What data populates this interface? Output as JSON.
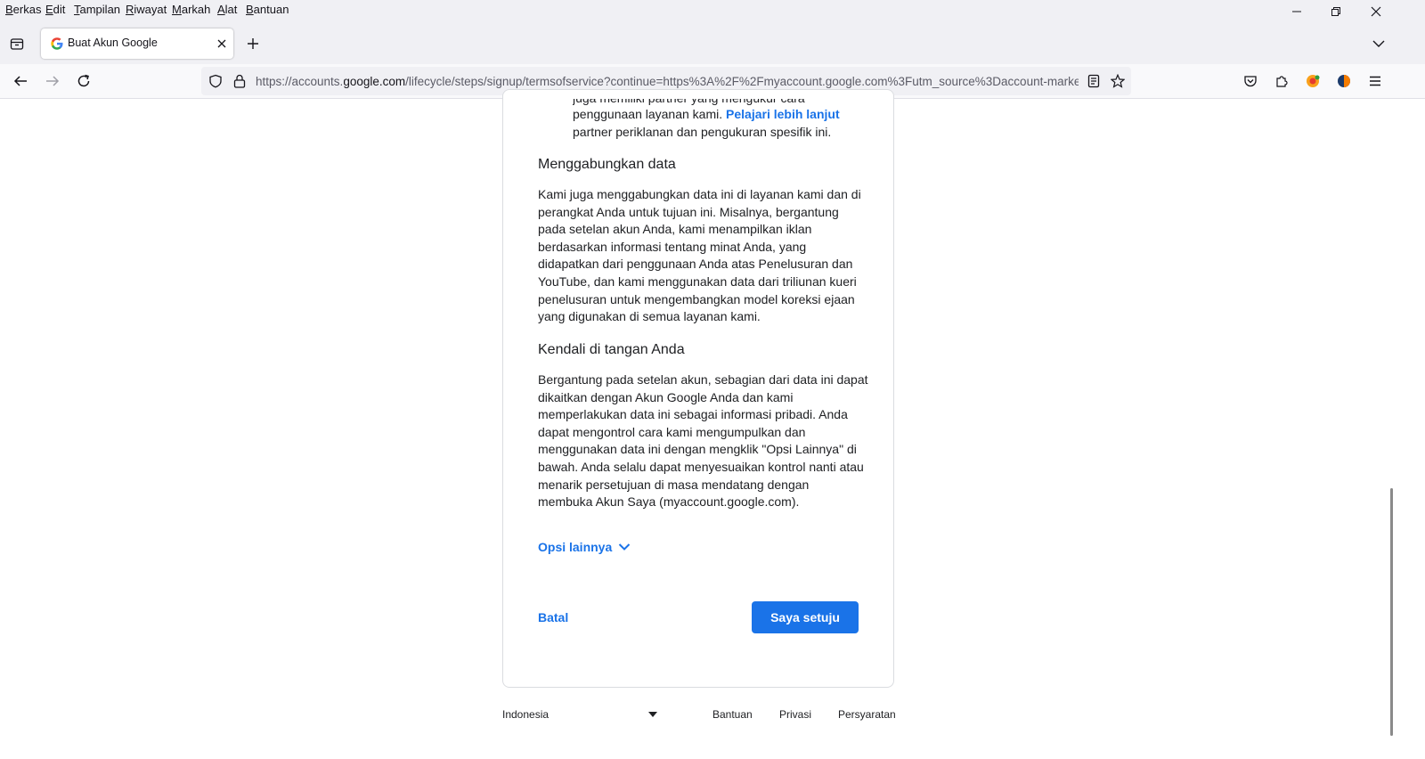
{
  "menubar": {
    "items": [
      "Berkas",
      "Edit",
      "Tampilan",
      "Riwayat",
      "Markah",
      "Alat",
      "Bantuan"
    ]
  },
  "tab": {
    "title": "Buat Akun Google"
  },
  "navbar": {
    "url_prefix": "https://accounts.",
    "url_host": "google.com",
    "url_path": "/lifecycle/steps/signup/termsofservice?continue=https%3A%2F%2Fmyaccount.google.com%3Futm_source%3Daccount-marke"
  },
  "content": {
    "partial_top_line": "juga memiliki partner yang mengukur cara",
    "bullet_line1": "penggunaan layanan kami. ",
    "bullet_link": "Pelajari lebih lanjut",
    "bullet_line2": "partner periklanan dan pengukuran spesifik ini.",
    "section1_heading": "Menggabungkan data",
    "section1_lines": [
      "Kami juga menggabungkan data ini di layanan kami dan di",
      "perangkat Anda untuk tujuan ini. Misalnya, bergantung",
      "pada setelan akun Anda, kami menampilkan iklan",
      "berdasarkan informasi tentang minat Anda, yang",
      "didapatkan dari penggunaan Anda atas Penelusuran dan",
      "YouTube, dan kami menggunakan data dari triliunan kueri",
      "penelusuran untuk mengembangkan model koreksi ejaan",
      "yang digunakan di semua layanan kami."
    ],
    "section2_heading": "Kendali di tangan Anda",
    "section2_lines": [
      "Bergantung pada setelan akun, sebagian dari data ini dapat",
      "dikaitkan dengan Akun Google Anda dan kami",
      "memperlakukan data ini sebagai informasi pribadi. Anda",
      "dapat mengontrol cara kami mengumpulkan dan",
      "menggunakan data ini dengan mengklik \"Opsi Lainnya\" di",
      "bawah. Anda selalu dapat menyesuaikan kontrol nanti atau",
      "menarik persetujuan di masa mendatang dengan",
      "membuka Akun Saya (myaccount.google.com)."
    ],
    "more_options": "Opsi lainnya",
    "cancel": "Batal",
    "agree": "Saya setuju"
  },
  "footer": {
    "language": "Indonesia",
    "help": "Bantuan",
    "privacy": "Privasi",
    "terms": "Persyaratan"
  },
  "colors": {
    "accent": "#1a73e8",
    "chrome_bg": "#f0f0f4"
  }
}
